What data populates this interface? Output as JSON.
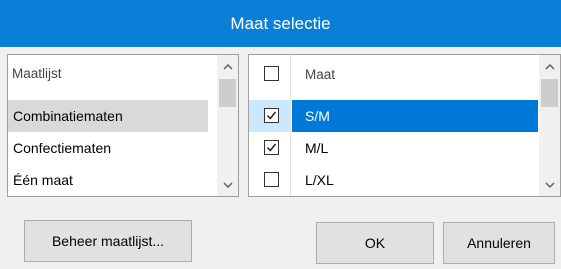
{
  "window": {
    "title": "Maat selectie"
  },
  "left_list": {
    "header": "Maatlijst",
    "items": [
      {
        "label": "Combinatiematen",
        "selected": true
      },
      {
        "label": "Confectiematen",
        "selected": false
      },
      {
        "label": "Één maat",
        "selected": false
      }
    ]
  },
  "right_grid": {
    "header": "Maat",
    "header_checked": false,
    "rows": [
      {
        "name": "S/M",
        "checked": true,
        "selected": true
      },
      {
        "name": "M/L",
        "checked": true,
        "selected": false
      },
      {
        "name": "L/XL",
        "checked": false,
        "selected": false
      }
    ]
  },
  "buttons": {
    "manage": "Beheer maatlijst...",
    "ok": "OK",
    "cancel": "Annuleren"
  },
  "colors": {
    "titlebar": "#0a7fd8",
    "selection": "#0078d7",
    "selection_light": "#cce8ff",
    "window_bg": "#f0f0f0"
  },
  "icons": [
    "chevron-up-icon",
    "chevron-down-icon",
    "checkmark-icon"
  ]
}
